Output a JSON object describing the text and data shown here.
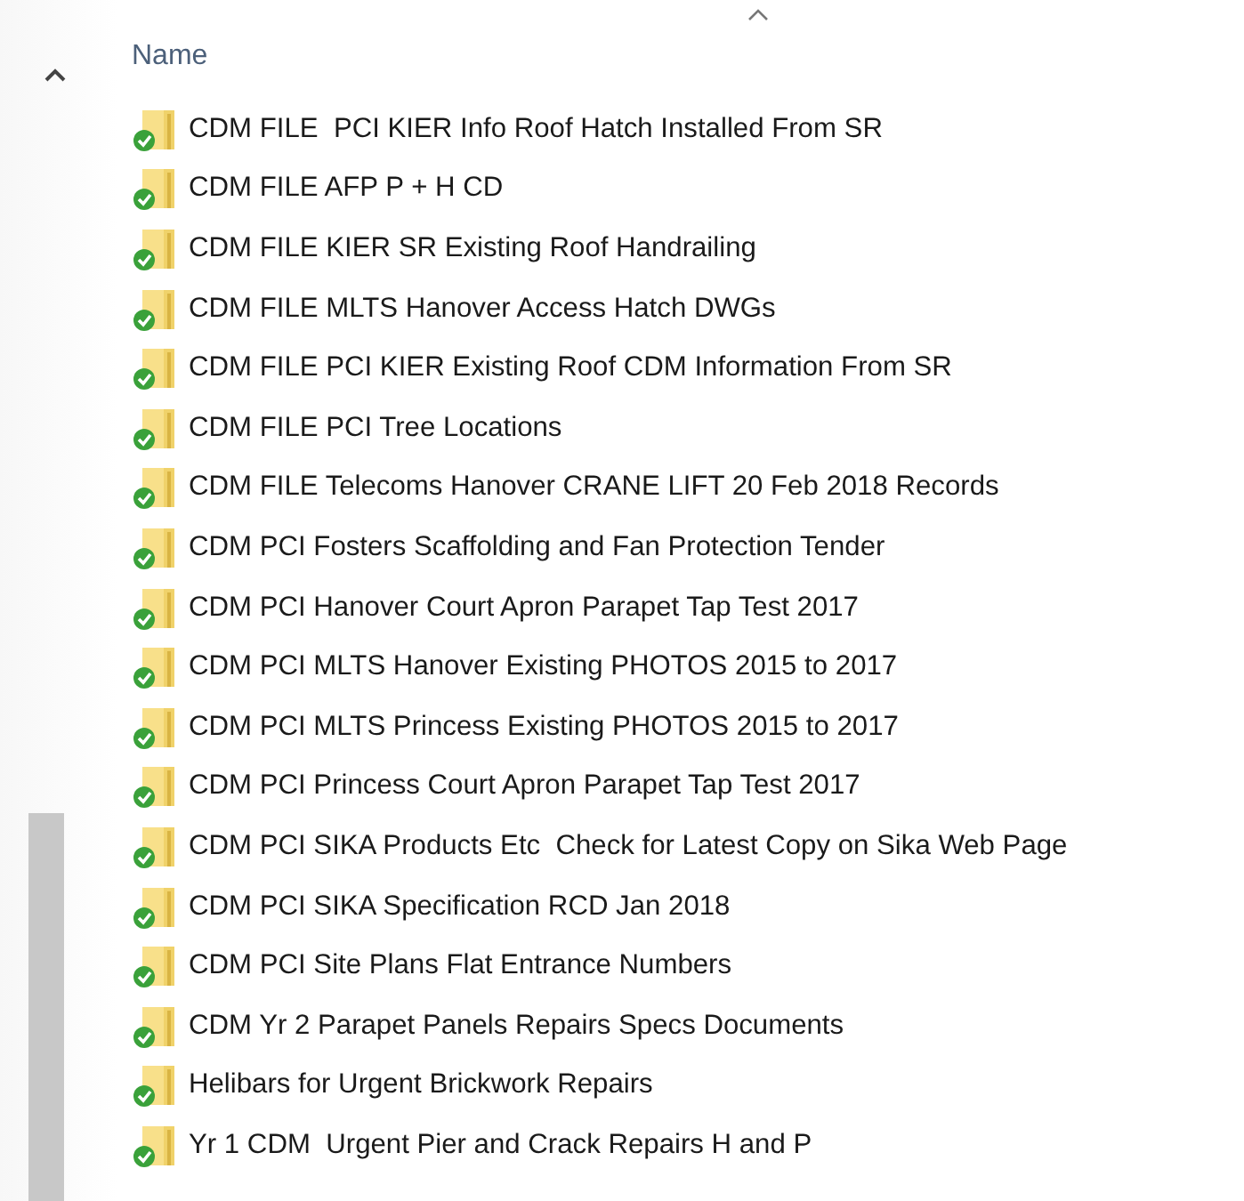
{
  "column_header": {
    "label": "Name",
    "sorted_ascending": true
  },
  "files": [
    {
      "name": "CDM FILE  PCI KIER Info Roof Hatch Installed From SR",
      "synced": true
    },
    {
      "name": "CDM FILE AFP P + H CD",
      "synced": true
    },
    {
      "name": "CDM FILE KIER SR Existing Roof Handrailing",
      "synced": true
    },
    {
      "name": "CDM FILE MLTS Hanover Access Hatch DWGs",
      "synced": true
    },
    {
      "name": "CDM FILE PCI KIER Existing Roof CDM Information From SR",
      "synced": true
    },
    {
      "name": "CDM FILE PCI Tree Locations",
      "synced": true
    },
    {
      "name": "CDM FILE Telecoms Hanover CRANE LIFT 20 Feb 2018 Records",
      "synced": true
    },
    {
      "name": "CDM PCI Fosters Scaffolding and Fan Protection Tender",
      "synced": true
    },
    {
      "name": "CDM PCI Hanover Court Apron Parapet Tap Test 2017",
      "synced": true
    },
    {
      "name": "CDM PCI MLTS Hanover Existing PHOTOS 2015 to 2017",
      "synced": true
    },
    {
      "name": "CDM PCI MLTS Princess Existing PHOTOS 2015 to 2017",
      "synced": true
    },
    {
      "name": "CDM PCI Princess Court Apron Parapet Tap Test 2017",
      "synced": true
    },
    {
      "name": "CDM PCI SIKA Products Etc  Check for Latest Copy on Sika Web Page",
      "synced": true
    },
    {
      "name": "CDM PCI SIKA Specification RCD Jan 2018",
      "synced": true
    },
    {
      "name": "CDM PCI Site Plans Flat Entrance Numbers",
      "synced": true
    },
    {
      "name": "CDM Yr 2 Parapet Panels Repairs Specs Documents",
      "synced": true
    },
    {
      "name": "Helibars for Urgent Brickwork Repairs",
      "synced": true
    },
    {
      "name": "Yr 1 CDM  Urgent Pier and Crack Repairs H and P",
      "synced": true
    }
  ]
}
